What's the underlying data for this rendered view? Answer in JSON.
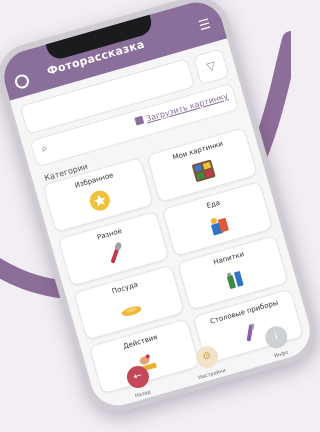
{
  "app": {
    "title": "Фоторассказка"
  },
  "search": {
    "upload_label": "Загрузить картинку"
  },
  "categories": {
    "title": "Категории",
    "items": [
      {
        "label": "Избранное",
        "icon": "star-icon",
        "color": "#f2c13b"
      },
      {
        "label": "Мои картинки",
        "icon": "photo-grid-icon",
        "color": "#3a78c9"
      },
      {
        "label": "Разное",
        "icon": "spoon-icon",
        "color": "#c3394a"
      },
      {
        "label": "Еда",
        "icon": "food-icon",
        "color": "#2e75c7"
      },
      {
        "label": "Посуда",
        "icon": "plate-icon",
        "color": "#f2b632"
      },
      {
        "label": "Напитки",
        "icon": "drinks-icon",
        "color": "#3b8a44"
      },
      {
        "label": "Действия",
        "icon": "hand-icon",
        "color": "#e5b232"
      },
      {
        "label": "Столовые приборы",
        "icon": "cutlery-icon",
        "color": "#8a5fb3"
      }
    ]
  },
  "nav": {
    "back_label": "Назад",
    "settings_label": "Настройки",
    "info_label": "Инфо"
  },
  "colors": {
    "accent": "#8a6f9a",
    "background": "#f3eef4"
  }
}
